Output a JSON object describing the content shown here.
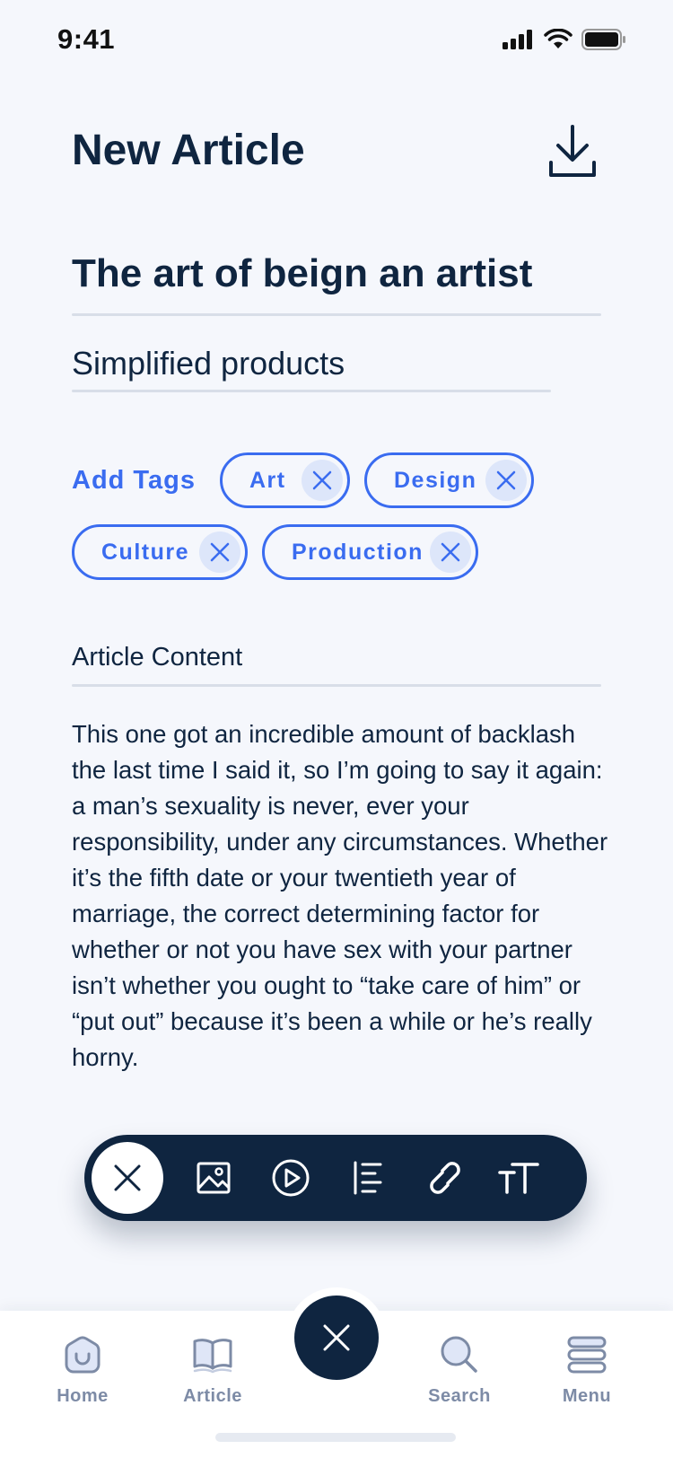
{
  "status_bar": {
    "time": "9:41",
    "icons": [
      "signal-icon",
      "wifi-icon",
      "battery-icon"
    ]
  },
  "header": {
    "title": "New Article",
    "download_icon": "download-icon"
  },
  "article": {
    "title_value": "The art of beign an artist",
    "subtitle_value": "Simplified products"
  },
  "tags": {
    "label": "Add Tags",
    "items": [
      "Art",
      "Design",
      "Culture",
      "Production"
    ]
  },
  "content": {
    "label": "Article Content",
    "body": "This one got an incredible amount of backlash the last time I said it, so I’m going to say it again: a man’s sexuality is never, ever your responsibility, under any circumstances. Whether it’s the fifth date or your twentieth year of marriage, the correct determining factor for whether or not you have sex with your partner isn’t whether you ought to “take care of him” or “put out” because it’s been a while or he’s really horny."
  },
  "toolbar": {
    "tools": [
      "close-icon",
      "image-icon",
      "play-icon",
      "list-icon",
      "link-icon",
      "text-size-icon"
    ]
  },
  "tabbar": {
    "home": "Home",
    "article": "Article",
    "search": "Search",
    "menu": "Menu"
  },
  "colors": {
    "accent": "#3a6cf0",
    "navy": "#0f2540",
    "muted": "#7d8ba6",
    "background": "#f5f7fc"
  }
}
